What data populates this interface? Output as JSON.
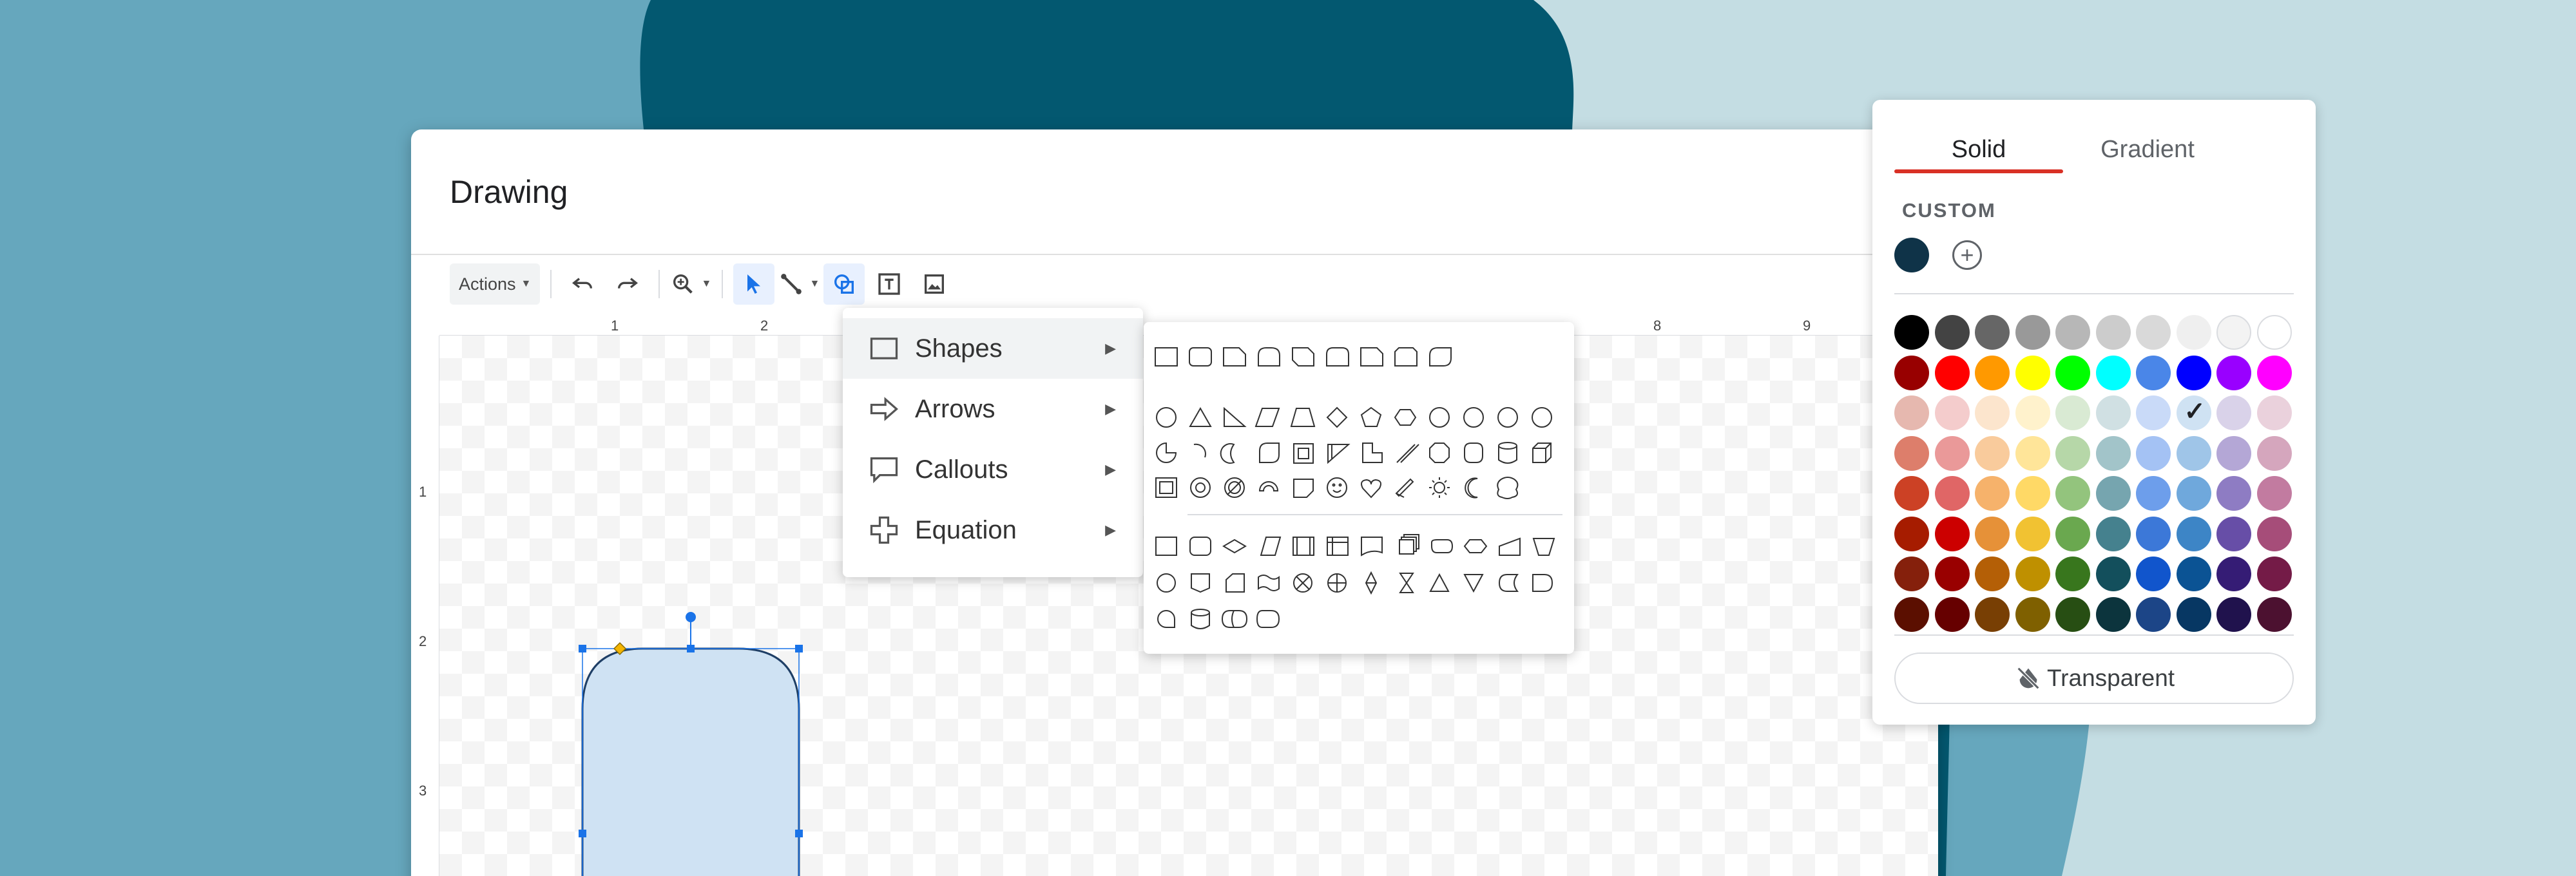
{
  "window": {
    "title": "Drawing"
  },
  "toolbar": {
    "actions_label": "Actions",
    "icons": [
      "undo-icon",
      "redo-icon",
      "zoom-icon",
      "select-icon",
      "line-icon",
      "shape-icon",
      "text-box-icon",
      "image-icon"
    ]
  },
  "ruler": {
    "top_numbers": [
      "1",
      "2",
      "8",
      "9"
    ],
    "left_numbers": [
      "1",
      "2",
      "3"
    ]
  },
  "shape_menu": {
    "items": [
      {
        "label": "Shapes",
        "icon": "square-icon"
      },
      {
        "label": "Arrows",
        "icon": "arrow-icon"
      },
      {
        "label": "Callouts",
        "icon": "callout-icon"
      },
      {
        "label": "Equation",
        "icon": "plus-icon"
      }
    ]
  },
  "shapes_submenu": {
    "sections": [
      "basic-rectangles",
      "basic-shapes",
      "flowchart"
    ]
  },
  "color_picker": {
    "tabs": {
      "solid": "Solid",
      "gradient": "Gradient"
    },
    "custom_label": "CUSTOM",
    "custom_colors": [
      "#0f3348"
    ],
    "palette": [
      [
        "#000000",
        "#434343",
        "#666666",
        "#999999",
        "#b7b7b7",
        "#cccccc",
        "#d9d9d9",
        "#efefef",
        "#f3f3f3",
        "#ffffff"
      ],
      [
        "#980000",
        "#ff0000",
        "#ff9900",
        "#ffff00",
        "#00ff00",
        "#00ffff",
        "#4a86e8",
        "#0000ff",
        "#9900ff",
        "#ff00ff"
      ],
      [
        "#e6b8af",
        "#f4cccc",
        "#fce5cd",
        "#fff2cc",
        "#d9ead3",
        "#d0e0e3",
        "#c9daf8",
        "#cfe2f3",
        "#d9d2e9",
        "#ead1dc"
      ],
      [
        "#dd7e6b",
        "#ea9999",
        "#f9cb9c",
        "#ffe599",
        "#b6d7a8",
        "#a2c4c9",
        "#a4c2f4",
        "#9fc5e8",
        "#b4a7d6",
        "#d5a6bd"
      ],
      [
        "#cc4125",
        "#e06666",
        "#f6b26b",
        "#ffd966",
        "#93c47d",
        "#76a5af",
        "#6d9eeb",
        "#6fa8dc",
        "#8e7cc3",
        "#c27ba0"
      ],
      [
        "#a61c00",
        "#cc0000",
        "#e69138",
        "#f1c232",
        "#6aa84f",
        "#45818e",
        "#3c78d8",
        "#3d85c6",
        "#674ea7",
        "#a64d79"
      ],
      [
        "#85200c",
        "#990000",
        "#b45f06",
        "#bf9000",
        "#38761d",
        "#134f5c",
        "#1155cc",
        "#0b5394",
        "#351c75",
        "#741b47"
      ],
      [
        "#5b0f00",
        "#660000",
        "#783f04",
        "#7f6000",
        "#274e13",
        "#0c343d",
        "#1c4587",
        "#073763",
        "#20124d",
        "#4c1130"
      ]
    ],
    "selected": {
      "row": 2,
      "col": 7
    },
    "transparent_label": "Transparent"
  },
  "colors": {
    "accent": "#1a73e8",
    "tab_underline": "#d93025",
    "shape_fill": "#cfe2f3",
    "bg_teal": "#66a7bd",
    "bg_dark": "#035870",
    "bg_light": "#c4dde3"
  }
}
